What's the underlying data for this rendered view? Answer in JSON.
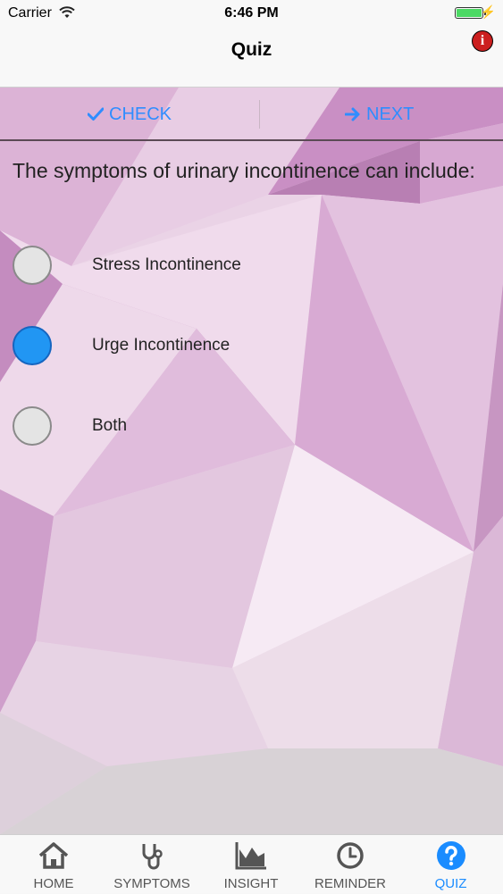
{
  "status_bar": {
    "carrier": "Carrier",
    "time": "6:46 PM"
  },
  "nav": {
    "title": "Quiz",
    "info_icon": "info-icon"
  },
  "actions": {
    "check_label": "CHECK",
    "next_label": "NEXT",
    "accent_color": "#2f8dff"
  },
  "question": {
    "text": "The symptoms of urinary incontinence can include:"
  },
  "options": [
    {
      "label": "Stress Incontinence",
      "selected": false
    },
    {
      "label": "Urge Incontinence",
      "selected": true
    },
    {
      "label": "Both",
      "selected": false
    }
  ],
  "tabs": [
    {
      "label": "HOME",
      "icon": "home-icon",
      "active": false
    },
    {
      "label": "SYMPTOMS",
      "icon": "stethoscope-icon",
      "active": false
    },
    {
      "label": "INSIGHT",
      "icon": "area-chart-icon",
      "active": false
    },
    {
      "label": "REMINDER",
      "icon": "clock-icon",
      "active": false
    },
    {
      "label": "QUIZ",
      "icon": "question-icon",
      "active": true
    }
  ]
}
